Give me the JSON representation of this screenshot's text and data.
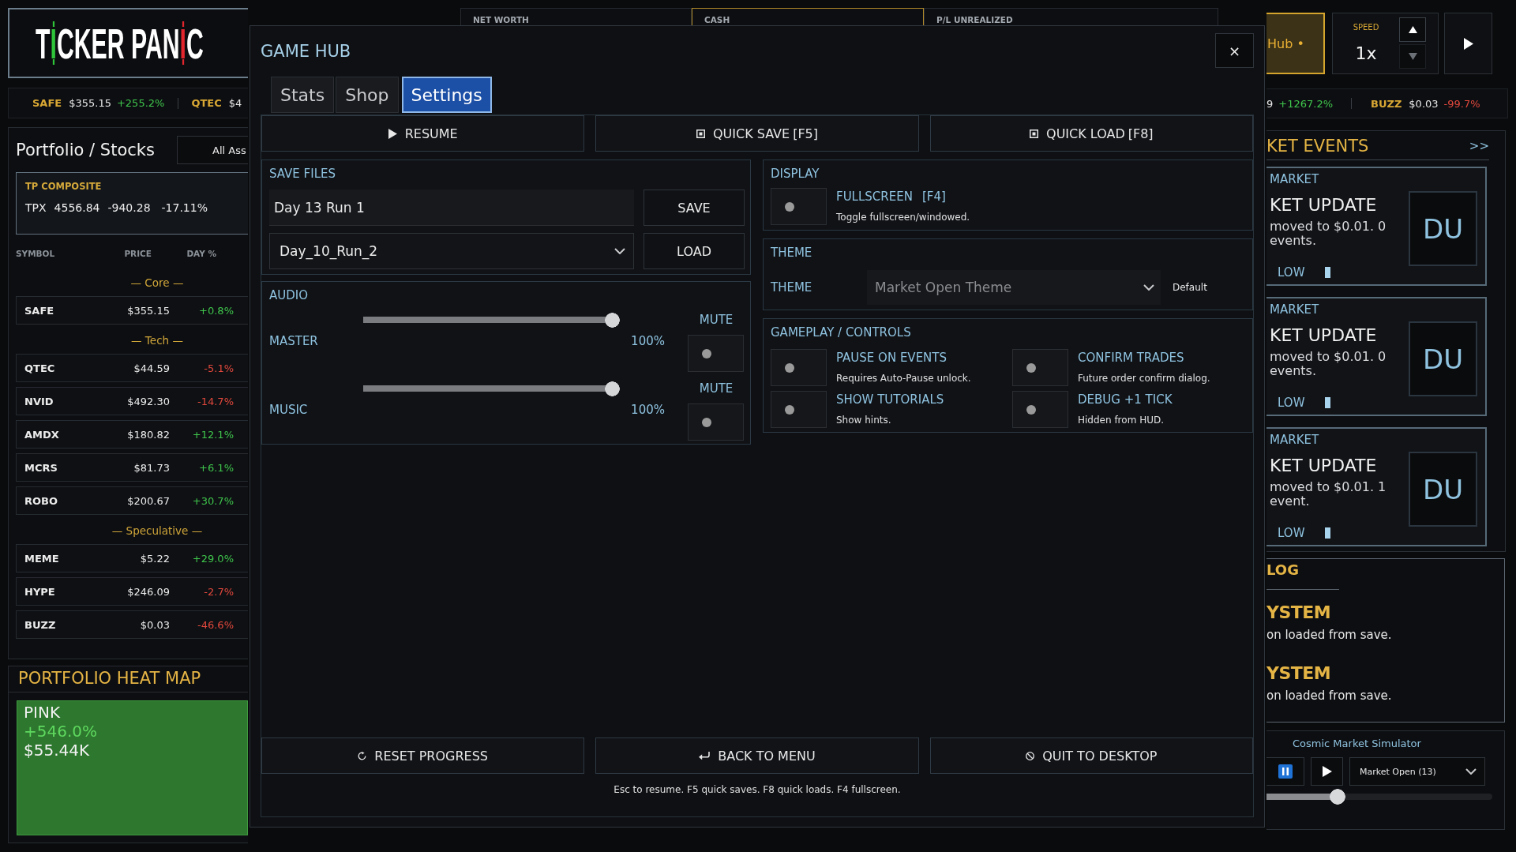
{
  "header": {
    "logo": [
      {
        "kind": "letter",
        "text": "T"
      },
      {
        "kind": "candle",
        "text": "I",
        "color": "#2fc53a"
      },
      {
        "kind": "letter",
        "text": "CKER PAN"
      },
      {
        "kind": "candle",
        "text": "I",
        "color": "#e3262e"
      },
      {
        "kind": "letter",
        "text": "C"
      }
    ],
    "stats": [
      {
        "label": "NET WORTH",
        "highlighted": false
      },
      {
        "label": "CASH",
        "highlighted": true
      },
      {
        "label": "P/L UNREALIZED",
        "highlighted": false
      }
    ],
    "hub_button": {
      "label": "Hub •",
      "highlighted": true
    },
    "speed": {
      "label": "SPEED",
      "value": "1x",
      "steppers": [
        {
          "kind": "up",
          "disabled": false
        },
        {
          "kind": "down",
          "disabled": true
        }
      ]
    }
  },
  "ticker_left": [
    {
      "symbol": "SAFE",
      "price": "$355.15",
      "change": "+255.2%",
      "gain": true
    },
    {
      "symbol": "QTEC",
      "price": "$4"
    }
  ],
  "ticker_right": [
    {
      "price": "9",
      "change": "+1267.2%",
      "gain": true
    },
    {
      "symbol": "BUZZ",
      "price": "$0.03",
      "change": "-99.7%",
      "gain": false
    }
  ],
  "portfolio": {
    "title": "Portfolio / Stocks",
    "filter": "All Ass",
    "composite": {
      "label": "TP COMPOSITE",
      "symbol": "TPX",
      "value": "4556.84",
      "change": "-940.28",
      "percent": "-17.11%"
    },
    "columns": [
      "SYMBOL",
      "PRICE",
      "DAY %"
    ],
    "groups": [
      {
        "name": "— Core —",
        "rows": [
          {
            "symbol": "SAFE",
            "price": "$355.15",
            "change": "+0.8%",
            "gain": true
          }
        ]
      },
      {
        "name": "— Tech —",
        "rows": [
          {
            "symbol": "QTEC",
            "price": "$44.59",
            "change": "-5.1%",
            "gain": false
          },
          {
            "symbol": "NVID",
            "price": "$492.30",
            "change": "-14.7%",
            "gain": false
          },
          {
            "symbol": "AMDX",
            "price": "$180.82",
            "change": "+12.1%",
            "gain": true
          },
          {
            "symbol": "MCRS",
            "price": "$81.73",
            "change": "+6.1%",
            "gain": true
          },
          {
            "symbol": "ROBO",
            "price": "$200.67",
            "change": "+30.7%",
            "gain": true
          }
        ]
      },
      {
        "name": "— Speculative —",
        "rows": [
          {
            "symbol": "MEME",
            "price": "$5.22",
            "change": "+29.0%",
            "gain": true
          },
          {
            "symbol": "HYPE",
            "price": "$246.09",
            "change": "-2.7%",
            "gain": false
          },
          {
            "symbol": "BUZZ",
            "price": "$0.03",
            "change": "-46.6%",
            "gain": false
          }
        ]
      }
    ]
  },
  "heat_map": {
    "title": "PORTFOLIO HEAT MAP",
    "tiles": [
      {
        "symbol": "PINK",
        "change": "+546.0%",
        "value": "$55.44K",
        "gain": true
      }
    ]
  },
  "market_events": {
    "title": "KET EVENTS",
    "expand": ">>",
    "events": [
      {
        "category": "MARKET",
        "title": "KET UPDATE",
        "body": "moved to $0.01. 0 events.",
        "severity": "LOW",
        "initials": "DU"
      },
      {
        "category": "MARKET",
        "title": "KET UPDATE",
        "body": "moved to $0.01. 0 events.",
        "severity": "LOW",
        "initials": "DU"
      },
      {
        "category": "MARKET",
        "title": "KET UPDATE",
        "body": "moved to $0.01. 1 event.",
        "severity": "LOW",
        "initials": "DU"
      }
    ]
  },
  "event_log": {
    "title": "LOG",
    "entries": [
      {
        "source": "YSTEM",
        "message": "on loaded from save."
      },
      {
        "source": "YSTEM",
        "message": "on loaded from save."
      }
    ]
  },
  "simulator": {
    "title": "Cosmic Market Simulator",
    "paused": true,
    "mode": "Market Open (13)",
    "level": 0.35
  },
  "game_hub": {
    "title": "GAME HUB",
    "close": "×",
    "tabs": [
      {
        "label": "Stats",
        "selected": false
      },
      {
        "label": "Shop",
        "selected": false
      },
      {
        "label": "Settings",
        "selected": true
      }
    ],
    "actions": [
      {
        "kind": "resume",
        "label": "RESUME"
      },
      {
        "kind": "save",
        "label": "QUICK SAVE",
        "hotkey": "[F5]"
      },
      {
        "kind": "load",
        "label": "QUICK LOAD",
        "hotkey": "[F8]"
      }
    ],
    "save_files": {
      "title": "SAVE FILES",
      "name_value": "Day 13 Run 1",
      "save_label": "SAVE",
      "slot_value": "Day_10_Run_2",
      "load_label": "LOAD"
    },
    "audio": {
      "title": "AUDIO",
      "channels": [
        {
          "name": "MASTER",
          "level": 1,
          "reading": "100%",
          "mute_label": "MUTE",
          "muted": false
        },
        {
          "name": "MUSIC",
          "level": 1,
          "reading": "100%",
          "mute_label": "MUTE",
          "muted": false
        }
      ]
    },
    "display": {
      "title": "DISPLAY",
      "options": [
        {
          "label": "FULLSCREEN",
          "hotkey": "[F4]",
          "description": "Toggle fullscreen/windowed.",
          "on": false
        }
      ]
    },
    "theme": {
      "title": "THEME",
      "field_label": "THEME",
      "value": "Market Open Theme",
      "disabled": true,
      "note": "Default"
    },
    "gameplay": {
      "title": "GAMEPLAY / CONTROLS",
      "options": [
        {
          "label": "PAUSE ON EVENTS",
          "description": "Requires Auto-Pause unlock.",
          "on": false
        },
        {
          "label": "CONFIRM TRADES",
          "description": "Future order confirm dialog.",
          "on": false
        },
        {
          "label": "SHOW TUTORIALS",
          "description": "Show hints.",
          "on": false
        },
        {
          "label": "DEBUG +1 TICK",
          "description": "Hidden from HUD.",
          "on": false
        }
      ]
    },
    "footer_actions": [
      {
        "kind": "reset",
        "label": "RESET PROGRESS"
      },
      {
        "kind": "back",
        "label": "BACK TO MENU"
      },
      {
        "kind": "quit",
        "label": "QUIT TO DESKTOP"
      }
    ],
    "hint": "Esc to resume. F5 quick saves. F8 quick loads. F4 fullscreen."
  }
}
